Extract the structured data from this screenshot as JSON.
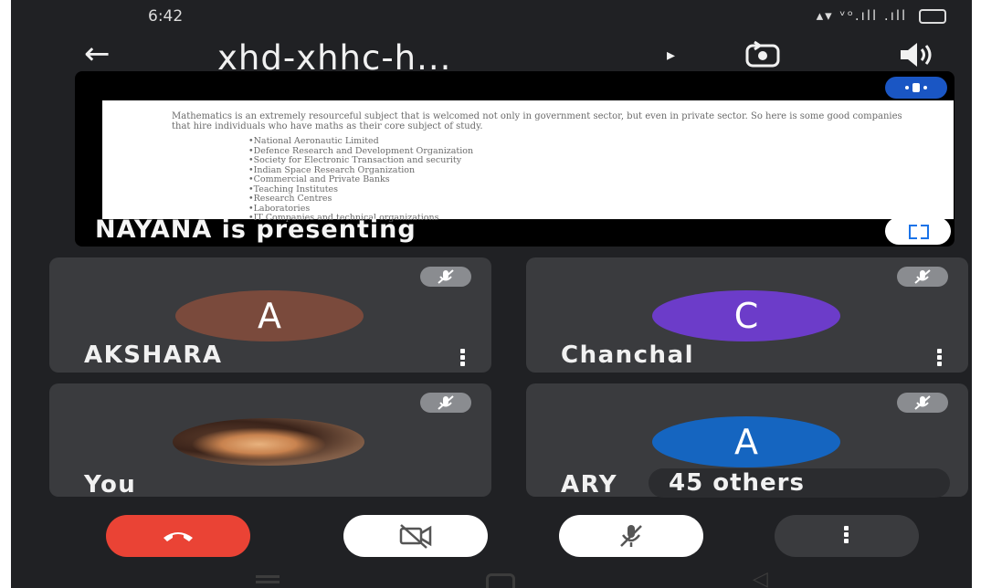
{
  "status_bar": {
    "time": "6:42",
    "indicators": "▴▾ ᵛᵒ.ıll .ıll"
  },
  "meeting": {
    "title": "xhd-xhhc-h...",
    "caret": "▸"
  },
  "presentation": {
    "paragraph": "Mathematics is an extremely resourceful subject that is welcomed not only in government sector, but even in private sector. So here is some good companies that hire individuals who have maths as their core subject of study.",
    "bullets": [
      "•National Aeronautic Limited",
      "•Defence Research and Development Organization",
      "•Society for Electronic Transaction and security",
      "•Indian Space Research Organization",
      "•Commercial and Private Banks",
      "•Teaching Institutes",
      "•Research Centres",
      "•Laboratories",
      "•IT Companies and technical organizations"
    ],
    "presenter_label": "NAYANA is presenting"
  },
  "participants": [
    {
      "name": "AKSHARA",
      "initial": "A",
      "avatar_color": "#7a4a3c"
    },
    {
      "name": "Chanchal",
      "initial": "C",
      "avatar_color": "#6c3cc9"
    },
    {
      "name": "You",
      "initial": "",
      "avatar_color": ""
    },
    {
      "name": "ARY",
      "initial": "A",
      "avatar_color": "#1565c0"
    }
  ],
  "others_label": "45 others",
  "colors": {
    "end_call": "#ea4335",
    "pin_chip": "#1a56c4",
    "tile": "#3a3b3e"
  },
  "icons": [
    "back-arrow-icon",
    "flip-camera-icon",
    "speaker-icon",
    "pin-icon",
    "fullscreen-icon",
    "mic-off-icon",
    "more-vert-icon",
    "hang-up-icon",
    "camera-off-icon"
  ]
}
